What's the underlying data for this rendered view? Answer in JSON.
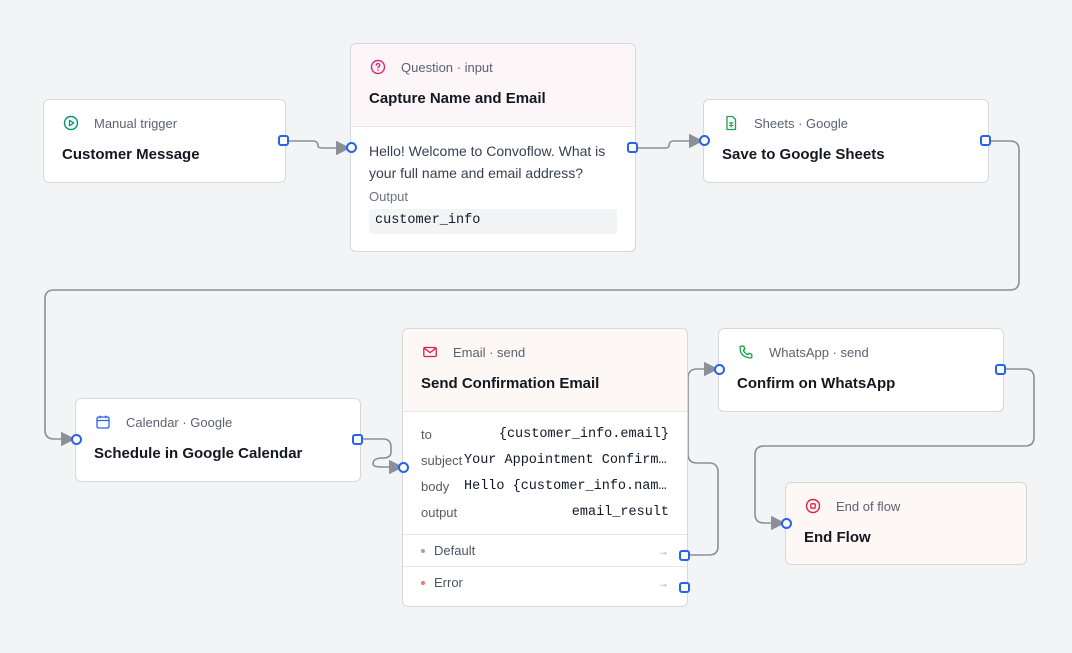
{
  "nodes": {
    "customer_message": {
      "kind": "Manual trigger",
      "title": "Customer Message"
    },
    "capture": {
      "kind": "Question · input",
      "title": "Capture Name and Email",
      "prompt": "Hello! Welcome to Convoflow. What is your full name and email address?",
      "output_label": "Output",
      "output_value": "customer_info"
    },
    "sheets": {
      "kind": "Sheets · Google",
      "title": "Save to Google Sheets"
    },
    "calendar": {
      "kind": "Calendar · Google",
      "title": "Schedule in Google Calendar"
    },
    "email": {
      "kind": "Email · send",
      "title": "Send Confirmation Email",
      "fields": [
        {
          "key": "to",
          "value": "{customer_info.email}"
        },
        {
          "key": "subject",
          "value": "Your Appointment Confirmation"
        },
        {
          "key": "body",
          "value": "Hello {customer_info.name}"
        },
        {
          "key": "output",
          "value": "email_result"
        }
      ],
      "outputs": [
        {
          "label": "Default",
          "color": "#9ca3af"
        },
        {
          "label": "Error",
          "color": "#f87171"
        }
      ]
    },
    "whatsapp": {
      "kind": "WhatsApp · send",
      "title": "Confirm on WhatsApp"
    },
    "end": {
      "kind": "End of flow",
      "title": "End Flow"
    }
  },
  "colors": {
    "port": "#2563eb",
    "edge": "#8a8f98",
    "trigger_icon": "#059669",
    "question_icon": "#db2777",
    "sheets_icon": "#16a34a",
    "calendar_icon": "#2563eb",
    "email_icon": "#e11d48",
    "whatsapp_icon": "#16a34a",
    "end_icon": "#e11d48"
  },
  "icons": {
    "customer_message": "play-circle-icon",
    "capture": "question-circle-icon",
    "sheets": "spreadsheet-icon",
    "calendar": "calendar-icon",
    "email": "mail-icon",
    "whatsapp": "phone-icon",
    "end": "stop-circle-icon"
  }
}
